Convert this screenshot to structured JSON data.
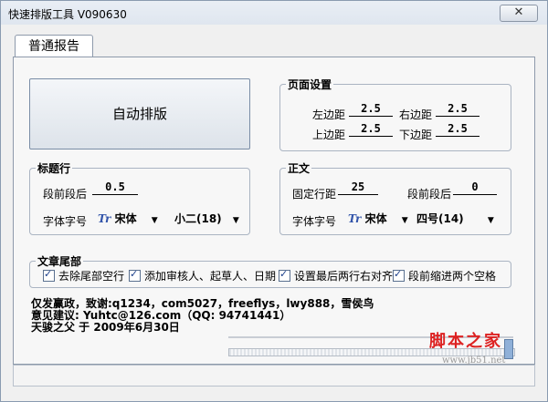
{
  "window": {
    "title": "快速排版工具 V090630",
    "close_glyph": "✕"
  },
  "tab": {
    "label": "普通报告"
  },
  "auto_button": "自动排版",
  "page_setup": {
    "legend": "页面设置",
    "left_margin_label": "左边距",
    "left_margin_value": "2.5",
    "right_margin_label": "右边距",
    "right_margin_value": "2.5",
    "top_margin_label": "上边距",
    "top_margin_value": "2.5",
    "bottom_margin_label": "下边距",
    "bottom_margin_value": "2.5"
  },
  "heading": {
    "legend": "标题行",
    "spacing_label": "段前段后",
    "spacing_value": "0.5",
    "font_label": "字体字号",
    "font_icon": "Tr",
    "font_name": "宋体",
    "font_size": "小二(18)"
  },
  "body_text": {
    "legend": "正文",
    "line_spacing_label": "固定行距",
    "line_spacing_value": "25",
    "para_spacing_label": "段前段后",
    "para_spacing_value": "0",
    "font_label": "字体字号",
    "font_icon": "Tr",
    "font_name": "宋体",
    "font_size": "四号(14)"
  },
  "tail": {
    "legend": "文章尾部",
    "options": [
      {
        "label": "去除尾部空行",
        "checked": true
      },
      {
        "label": "添加审核人、起草人、日期",
        "checked": true
      },
      {
        "label": "设置最后两行右对齐",
        "checked": true
      },
      {
        "label": "段前缩进两个空格",
        "checked": true
      }
    ]
  },
  "credits": [
    "仅发赢政，致谢:q1234，com5027，freeflys，lwy888，雪侯鸟",
    "意见建议: Yuhtc@126.com（QQ: 94741441）",
    "天骏之父 于 2009年6月30日"
  ],
  "watermark": {
    "main": "脚本之家",
    "sub": "www.jb51.net"
  },
  "colors": {
    "accent": "#3355aa",
    "watermark": "#dd2222"
  }
}
